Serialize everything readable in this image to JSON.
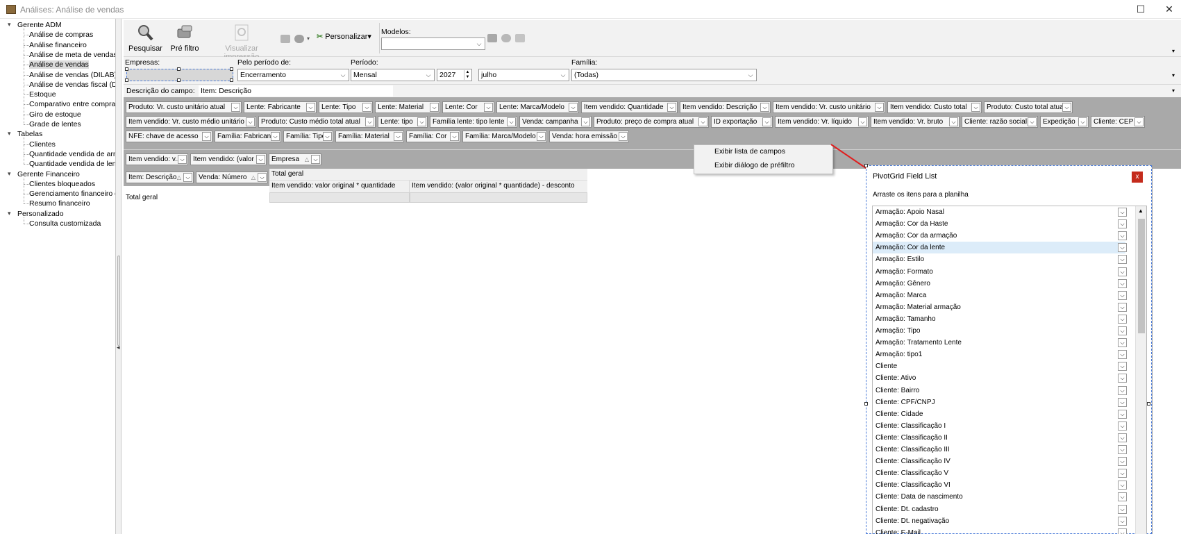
{
  "window": {
    "title": "Análises: Análise de vendas",
    "maximize": "☐",
    "close": "✕"
  },
  "sidebar": {
    "groups": [
      {
        "label": "Gerente ADM",
        "items": [
          "Análise de compras",
          "Análise financeiro",
          "Análise de meta de vendas",
          "Análise de vendas",
          "Análise de vendas (DILAB)",
          "Análise de vendas fiscal (DIL...",
          "Estoque",
          "Comparativo entre compra e...",
          "Giro de estoque",
          "Grade de lentes"
        ]
      },
      {
        "label": "Tabelas",
        "items": [
          "Clientes",
          "Quantidade vendida de arma...",
          "Quantidade vendida de lente..."
        ]
      },
      {
        "label": "Gerente Financeiro",
        "items": [
          "Clientes bloqueados",
          "Gerenciamento financeiro de...",
          "Resumo financeiro"
        ]
      },
      {
        "label": "Personalizado",
        "items": [
          "Consulta customizada"
        ]
      }
    ],
    "selected": "Análise de vendas",
    "expander": "▾",
    "collapse_arrow": "◂"
  },
  "toolbar": {
    "search": "Pesquisar",
    "prefilter": "Pré filtro",
    "print_preview": "Visualizar impressão",
    "customize": "Personalizar",
    "customize_arrow": "▾",
    "models_label": "Modelos:",
    "models_value": ""
  },
  "filters": {
    "empresas_label": "Empresas:",
    "periodo_de_label": "Pelo período de:",
    "periodo_de_value": "Encerramento",
    "periodo_label": "Período:",
    "periodo_value": "Mensal",
    "year_value": "2027",
    "month_value": "julho",
    "familia_label": "Família:",
    "familia_value": "(Todas)"
  },
  "descricao": {
    "label": "Descrição do campo:",
    "value": "Item: Descrição"
  },
  "filter_fields": [
    [
      "Produto: Vr. custo unitário atual",
      "Lente: Fabricante",
      "Lente: Tipo",
      "Lente: Material",
      "Lente: Cor",
      "Lente: Marca/Modelo",
      "Item vendido: Quantidade",
      "Item vendido: Descrição",
      "Item vendido: Vr. custo unitário",
      "Item vendido: Custo total",
      "Produto: Custo total atual"
    ],
    [
      "Item vendido: Vr. custo médio unitário",
      "Produto: Custo médio total atual",
      "Lente: tipo",
      "Família lente: tipo lente",
      "Venda: campanha",
      "Produto: preço de compra atual",
      "ID exportação",
      "Item vendido: Vr. líquido",
      "Item vendido: Vr. bruto",
      "Cliente: razão social",
      "Expedição",
      "Cliente: CEP"
    ],
    [
      "NFE: chave de acesso",
      "Família: Fabricante",
      "Família: Tipo",
      "Família: Material",
      "Família: Cor",
      "Família: Marca/Modelo",
      "Venda: hora emissão"
    ]
  ],
  "data_fields": [
    "Item vendido: v...",
    "Item vendido: (valor o...",
    "Empresa"
  ],
  "row_fields": [
    "Item: Descrição",
    "Venda: Número"
  ],
  "grid": {
    "col_grand_total": "Total geral",
    "col1": "Item vendido: valor original * quantidade",
    "col2": "Item vendido: (valor original * quantidade) - desconto",
    "row_grand_total": "Total geral"
  },
  "context_menu": {
    "items": [
      "Exibir lista de campos",
      "Exibir diálogo de préfiltro"
    ]
  },
  "field_list": {
    "title": "PivotGrid Field List",
    "close": "x",
    "hint": "Arraste os itens para a planilha",
    "items": [
      "Armação: Apoio Nasal",
      "Armação: Cor da Haste",
      "Armação: Cor da armação",
      "Armação: Cor da lente",
      "Armação: Estilo",
      "Armação: Formato",
      "Armação: Gênero",
      "Armação: Marca",
      "Armação: Material armação",
      "Armação: Tamanho",
      "Armação: Tipo",
      "Armação: Tratamento Lente",
      "Armação: tipo1",
      "Cliente",
      "Cliente: Ativo",
      "Cliente: Bairro",
      "Cliente: CPF/CNPJ",
      "Cliente: Cidade",
      "Cliente: Classificação I",
      "Cliente: Classificação II",
      "Cliente: Classificação III",
      "Cliente: Classificação IV",
      "Cliente: Classificação V",
      "Cliente: Classificação VI",
      "Cliente: Data de nascimento",
      "Cliente: Dt. cadastro",
      "Cliente: Dt. negativação",
      "Cliente: E-Mail"
    ],
    "highlighted_index": 3,
    "dropdown_glyph": "⌵",
    "scroll_up": "▲"
  },
  "colors": {
    "accent_red": "#e02020",
    "selection": "#dcecf9",
    "field_area": "#a9a9a9"
  }
}
